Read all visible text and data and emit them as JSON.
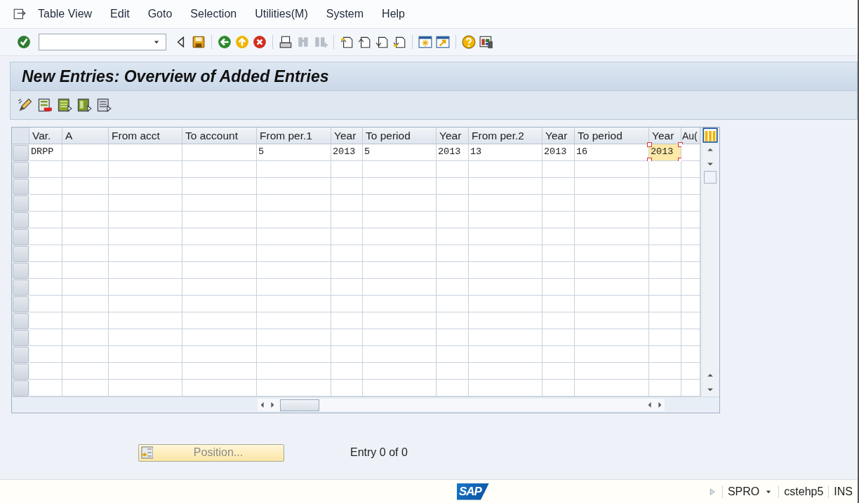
{
  "menu": [
    {
      "label": "Table View"
    },
    {
      "label": "Edit"
    },
    {
      "label": "Goto"
    },
    {
      "label": "Selection"
    },
    {
      "label": "Utilities(M)"
    },
    {
      "label": "System"
    },
    {
      "label": "Help"
    }
  ],
  "screen_title": "New Entries: Overview of Added Entries",
  "table": {
    "columns": [
      "Var.",
      "A",
      "From acct",
      "To account",
      "From per.1",
      "Year",
      "To period",
      "Year",
      "From per.2",
      "Year",
      "To period",
      "Year",
      "Au("
    ],
    "rows": [
      {
        "cells": [
          {
            "text": "DRPP",
            "selected": false
          },
          {
            "selected": false
          },
          {
            "selected": false
          },
          {
            "selected": false
          },
          {
            "text": "5",
            "selected": false
          },
          {
            "text": "2013",
            "selected": false
          },
          {
            "text": "5",
            "selected": false
          },
          {
            "text": "2013",
            "selected": false
          },
          {
            "text": "13",
            "selected": false
          },
          {
            "text": "2013",
            "selected": false
          },
          {
            "text": "16",
            "selected": false
          },
          {
            "text": "2013",
            "selected": true
          },
          {
            "selected": false
          }
        ]
      }
    ]
  },
  "position_button": "Position...",
  "entry_count": "Entry 0 of 0",
  "status_bar": {
    "logo": "SAP",
    "transaction": "SPRO",
    "server": "cstehp5",
    "mode": "INS"
  }
}
